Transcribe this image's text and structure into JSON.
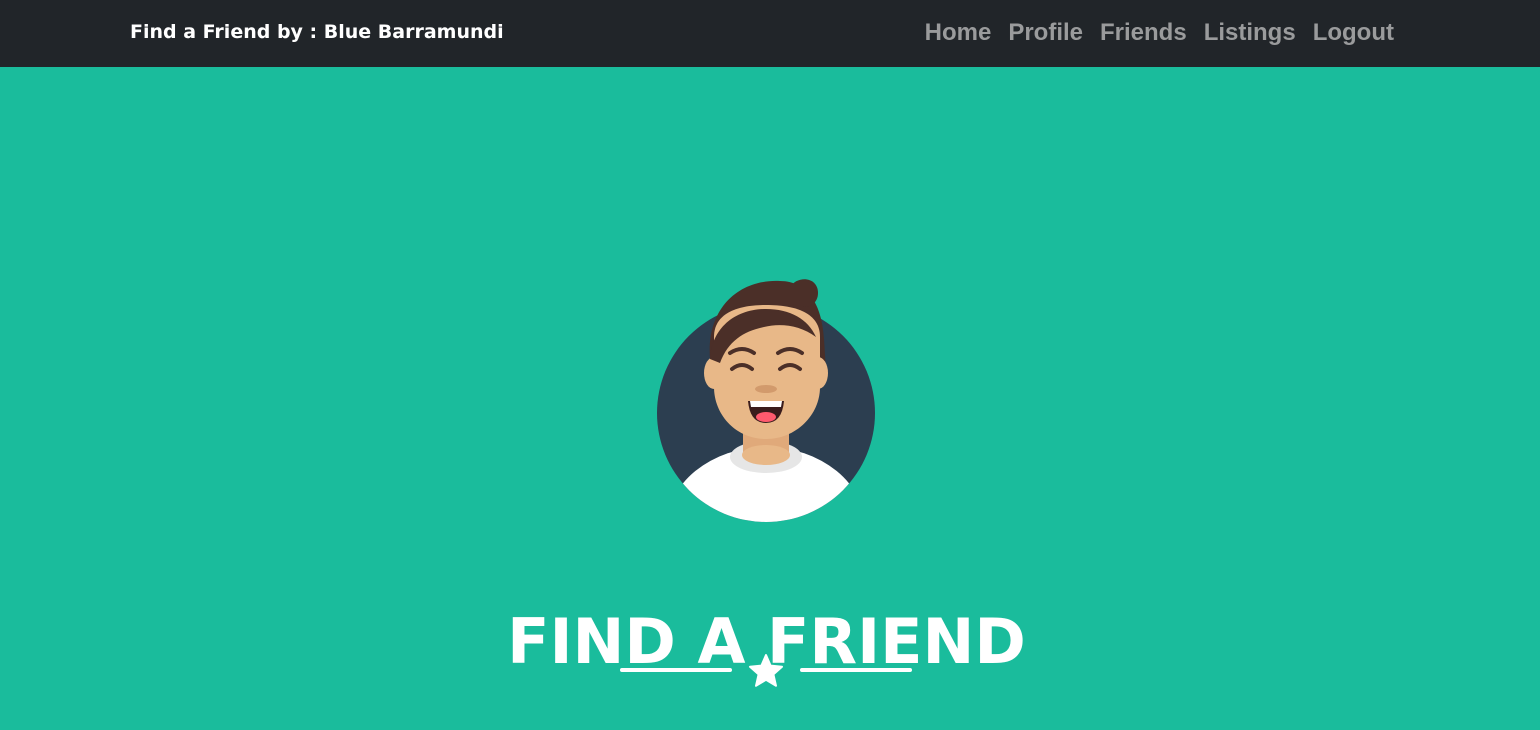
{
  "navbar": {
    "brand": "Find a Friend by : Blue Barramundi",
    "links": [
      {
        "label": "Home"
      },
      {
        "label": "Profile"
      },
      {
        "label": "Friends"
      },
      {
        "label": "Listings"
      },
      {
        "label": "Logout"
      }
    ]
  },
  "masthead": {
    "avatar_icon": "avatar-icon",
    "title": "FIND A FRIEND",
    "divider_icon": "star-icon"
  },
  "colors": {
    "navbar_bg": "#212529",
    "nav_link": "#9a9b9c",
    "masthead_bg": "#1abc9c",
    "text": "#ffffff",
    "avatar_bg": "#2c3e50"
  }
}
